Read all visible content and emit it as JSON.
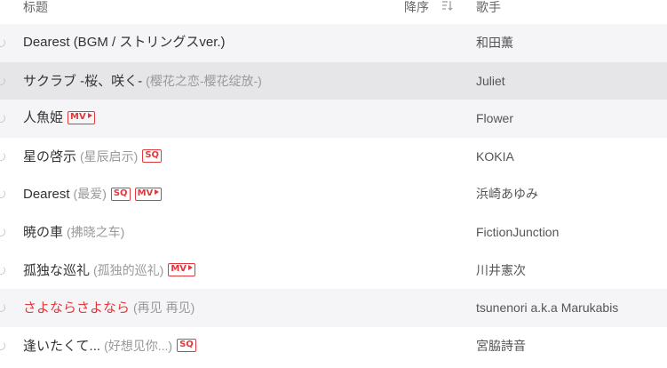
{
  "header": {
    "title": "标题",
    "sort": "降序",
    "artist": "歌手"
  },
  "colors": {
    "accent": "#e0393e",
    "selected_row": "#e6e6e8",
    "alt_row": "#f5f5f7"
  },
  "tracks": [
    {
      "title": "Dearest (BGM / ストリングスver.)",
      "subtitle": "",
      "badges": [],
      "artist": "和田薫"
    },
    {
      "title": "サクラブ -桜、咲く-",
      "subtitle": "(樱花之恋-樱花绽放-)",
      "badges": [],
      "artist": "Juliet"
    },
    {
      "title": "人魚姫",
      "subtitle": "",
      "badges": [
        "MV"
      ],
      "artist": "Flower"
    },
    {
      "title": "星の啓示",
      "subtitle": "(星辰启示)",
      "badges": [
        "SQ"
      ],
      "artist": "KOKIA"
    },
    {
      "title": "Dearest",
      "subtitle": "(最爱)",
      "badges": [
        "SQ",
        "MV"
      ],
      "artist": "浜崎あゆみ"
    },
    {
      "title": "暁の車",
      "subtitle": "(拂晓之车)",
      "badges": [],
      "artist": "FictionJunction"
    },
    {
      "title": "孤独な巡礼",
      "subtitle": "(孤独的巡礼)",
      "badges": [
        "MV"
      ],
      "artist": "川井憲次"
    },
    {
      "title": "さよならさよなら",
      "subtitle": "(再见 再见)",
      "badges": [],
      "artist": "tsunenori a.k.a Marukabis"
    },
    {
      "title": "逢いたくて...",
      "subtitle": "(好想见你...)",
      "badges": [
        "SQ"
      ],
      "artist": "宮脇詩音"
    }
  ]
}
